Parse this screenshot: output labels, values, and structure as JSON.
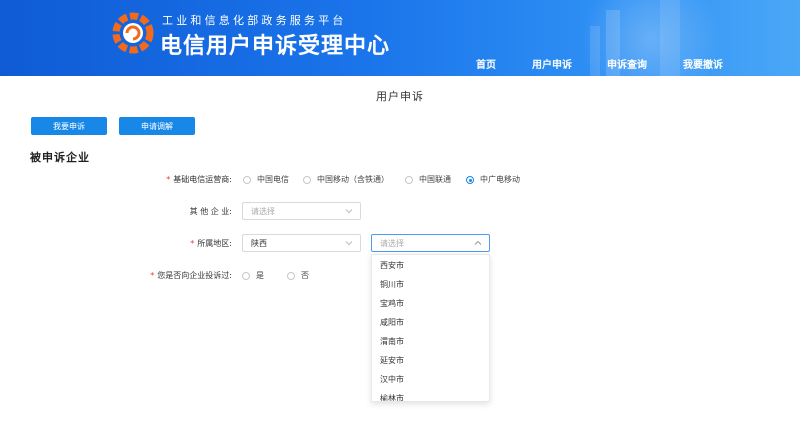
{
  "header": {
    "subtitle": "工业和信息化部政务服务平台",
    "title": "电信用户申诉受理中心",
    "nav": [
      "首页",
      "用户申诉",
      "申诉查询",
      "我要撤诉"
    ]
  },
  "page_heading": "用户申诉",
  "buttons": {
    "complain": "我要申诉",
    "mediation": "申请调解"
  },
  "section_title": "被申诉企业",
  "form": {
    "operator": {
      "label": "基础电信运营商:",
      "options": [
        "中国电信",
        "中国移动（含铁通）",
        "中国联通",
        "中广电移动"
      ],
      "selected": "中广电移动"
    },
    "other_company": {
      "label": "其 他 企 业:",
      "placeholder": "请选择"
    },
    "region": {
      "label": "所属地区:",
      "province": "陕西",
      "city_placeholder": "请选择",
      "city_options": [
        "西安市",
        "铜川市",
        "宝鸡市",
        "咸阳市",
        "渭南市",
        "延安市",
        "汉中市",
        "榆林市"
      ]
    },
    "complained_before": {
      "label": "您是否向企业投诉过:",
      "options": [
        "是",
        "否"
      ]
    }
  },
  "colors": {
    "accent": "#1788e8",
    "header_start": "#0f5bd6",
    "header_end": "#4aa7f7",
    "required": "#e23b3b"
  }
}
